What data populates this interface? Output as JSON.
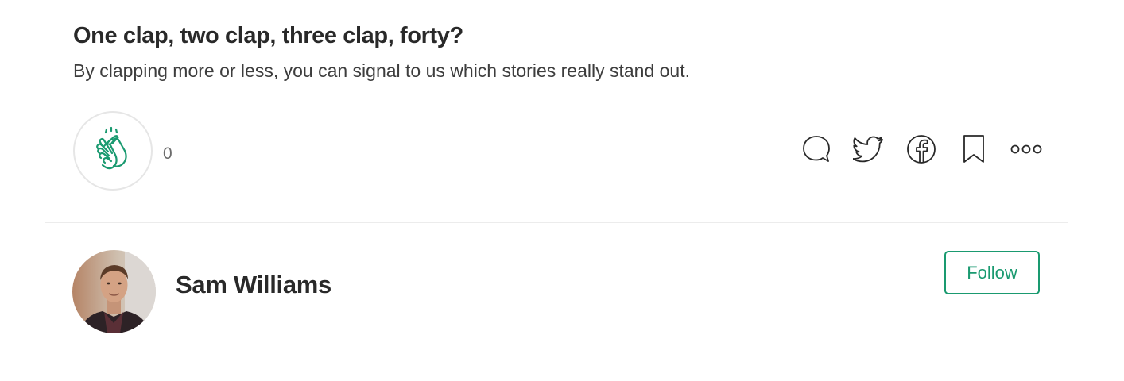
{
  "banner": {
    "title": "One clap, two clap, three clap, forty?",
    "subtitle": "By clapping more or less, you can signal to us which stories really stand out."
  },
  "clap": {
    "icon": "clap-icon",
    "count": "0",
    "accent_color": "#1a9a70"
  },
  "actions": [
    {
      "icon": "comment-icon"
    },
    {
      "icon": "twitter-icon"
    },
    {
      "icon": "facebook-icon"
    },
    {
      "icon": "bookmark-icon"
    },
    {
      "icon": "more-icon"
    }
  ],
  "author": {
    "name": "Sam Williams",
    "avatar_icon": "avatar",
    "follow_label": "Follow",
    "follow_color": "#1a9a70"
  }
}
